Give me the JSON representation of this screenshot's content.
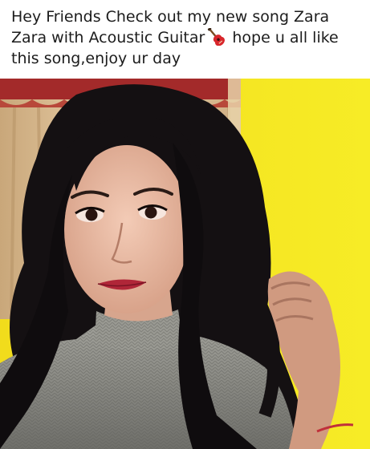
{
  "post": {
    "caption_part1": "Hey Friends Check out my new song Zara Zara with Acoustic Guitar",
    "caption_emoji": "guitar-icon",
    "caption_part2": " hope u all like this song,enjoy ur day"
  },
  "photo": {
    "subject": "selfie",
    "colors": {
      "background_yellow": "#f4e71b",
      "curtain": "#e3c8a3",
      "curtain_red": "#a32a2a",
      "hair": "#141012",
      "skin": "#e7b7a0",
      "sweater": "#8f8f88"
    }
  }
}
